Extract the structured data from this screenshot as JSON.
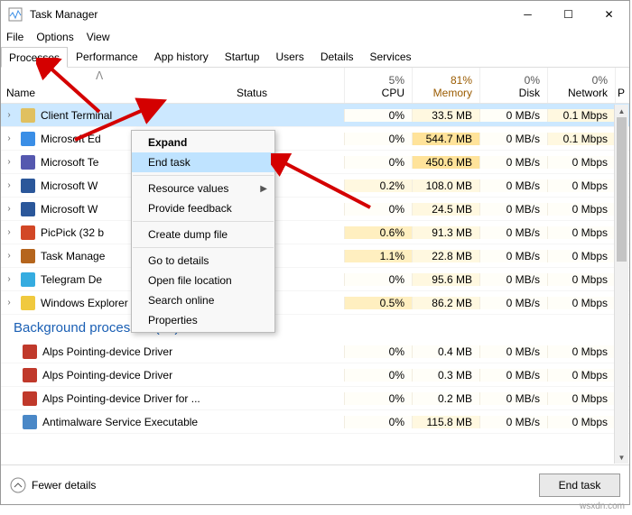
{
  "window": {
    "title": "Task Manager"
  },
  "menu": {
    "file": "File",
    "options": "Options",
    "view": "View"
  },
  "tabs": [
    "Processes",
    "Performance",
    "App history",
    "Startup",
    "Users",
    "Details",
    "Services"
  ],
  "headers": {
    "name": "Name",
    "status": "Status",
    "cpu": {
      "pct": "5%",
      "label": "CPU"
    },
    "memory": {
      "pct": "81%",
      "label": "Memory"
    },
    "disk": {
      "pct": "0%",
      "label": "Disk"
    },
    "network": {
      "pct": "0%",
      "label": "Network"
    },
    "p": "P"
  },
  "groups": {
    "bg": "Background processes (73)"
  },
  "rows": [
    {
      "name": "Client Terminal",
      "selected": true,
      "cpu": "0%",
      "ccpu": 0,
      "mem": "33.5 MB",
      "cmem": 1,
      "disk": "0 MB/s",
      "cdisk": 0,
      "net": "0.1 Mbps",
      "cnet": 1,
      "icon": "#e0c060"
    },
    {
      "name": "Microsoft Ed",
      "cpu": "0%",
      "ccpu": 0,
      "mem": "544.7 MB",
      "cmem": 3,
      "disk": "0 MB/s",
      "cdisk": 0,
      "net": "0.1 Mbps",
      "cnet": 1,
      "icon": "#3a8ee6"
    },
    {
      "name": "Microsoft Te",
      "cpu": "0%",
      "ccpu": 0,
      "mem": "450.6 MB",
      "cmem": 3,
      "disk": "0 MB/s",
      "cdisk": 0,
      "net": "0 Mbps",
      "cnet": 0,
      "icon": "#5558af"
    },
    {
      "name": "Microsoft W",
      "cpu": "0.2%",
      "ccpu": 1,
      "mem": "108.0 MB",
      "cmem": 1,
      "disk": "0 MB/s",
      "cdisk": 0,
      "net": "0 Mbps",
      "cnet": 0,
      "icon": "#2b579a"
    },
    {
      "name": "Microsoft W",
      "cpu": "0%",
      "ccpu": 0,
      "mem": "24.5 MB",
      "cmem": 1,
      "disk": "0 MB/s",
      "cdisk": 0,
      "net": "0 Mbps",
      "cnet": 0,
      "icon": "#2b579a"
    },
    {
      "name": "PicPick (32 b",
      "cpu": "0.6%",
      "ccpu": 2,
      "mem": "91.3 MB",
      "cmem": 1,
      "disk": "0 MB/s",
      "cdisk": 0,
      "net": "0 Mbps",
      "cnet": 0,
      "icon": "#d24726"
    },
    {
      "name": "Task Manage",
      "cpu": "1.1%",
      "ccpu": 2,
      "mem": "22.8 MB",
      "cmem": 1,
      "disk": "0 MB/s",
      "cdisk": 0,
      "net": "0 Mbps",
      "cnet": 0,
      "icon": "#b5651d"
    },
    {
      "name": "Telegram De",
      "cpu": "0%",
      "ccpu": 0,
      "mem": "95.6 MB",
      "cmem": 1,
      "disk": "0 MB/s",
      "cdisk": 0,
      "net": "0 Mbps",
      "cnet": 0,
      "icon": "#35ace0"
    },
    {
      "name": "Windows Explorer",
      "cpu": "0.5%",
      "ccpu": 2,
      "mem": "86.2 MB",
      "cmem": 1,
      "disk": "0 MB/s",
      "cdisk": 0,
      "net": "0 Mbps",
      "cnet": 0,
      "icon": "#f0c93e"
    }
  ],
  "bgRows": [
    {
      "name": "Alps Pointing-device Driver",
      "cpu": "0%",
      "ccpu": 0,
      "mem": "0.4 MB",
      "cmem": 0,
      "disk": "0 MB/s",
      "cdisk": 0,
      "net": "0 Mbps",
      "cnet": 0,
      "icon": "#c0392b"
    },
    {
      "name": "Alps Pointing-device Driver",
      "cpu": "0%",
      "ccpu": 0,
      "mem": "0.3 MB",
      "cmem": 0,
      "disk": "0 MB/s",
      "cdisk": 0,
      "net": "0 Mbps",
      "cnet": 0,
      "icon": "#c0392b"
    },
    {
      "name": "Alps Pointing-device Driver for ...",
      "cpu": "0%",
      "ccpu": 0,
      "mem": "0.2 MB",
      "cmem": 0,
      "disk": "0 MB/s",
      "cdisk": 0,
      "net": "0 Mbps",
      "cnet": 0,
      "icon": "#c0392b"
    },
    {
      "name": "Antimalware Service Executable",
      "cpu": "0%",
      "ccpu": 0,
      "mem": "115.8 MB",
      "cmem": 1,
      "disk": "0 MB/s",
      "cdisk": 0,
      "net": "0 Mbps",
      "cnet": 0,
      "icon": "#4a88c7"
    }
  ],
  "context": {
    "expand": "Expand",
    "end": "End task",
    "resource": "Resource values",
    "feedback": "Provide feedback",
    "dump": "Create dump file",
    "go": "Go to details",
    "open": "Open file location",
    "search": "Search online",
    "prop": "Properties"
  },
  "footer": {
    "fewer": "Fewer details",
    "end": "End task"
  },
  "watermark": "wsxdn.com"
}
